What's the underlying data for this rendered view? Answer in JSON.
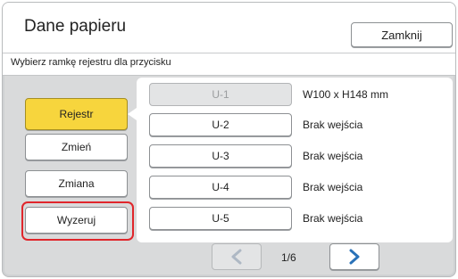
{
  "header": {
    "title": "Dane papieru",
    "close_label": "Zamknij"
  },
  "subtitle": "Wybierz ramkę rejestru dla przycisku",
  "actions": [
    {
      "label": "Rejestr",
      "active": true
    },
    {
      "label": "Zmień",
      "active": false
    },
    {
      "label": "Zmiana",
      "active": false
    },
    {
      "label": "Wyzeruj",
      "active": false,
      "highlighted": true
    }
  ],
  "slots": [
    {
      "label": "U-1",
      "status": "W100 x H148 mm",
      "disabled": true
    },
    {
      "label": "U-2",
      "status": "Brak wejścia",
      "disabled": false
    },
    {
      "label": "U-3",
      "status": "Brak wejścia",
      "disabled": false
    },
    {
      "label": "U-4",
      "status": "Brak wejścia",
      "disabled": false
    },
    {
      "label": "U-5",
      "status": "Brak wejścia",
      "disabled": false
    }
  ],
  "pagination": {
    "indicator": "1/6",
    "prev_icon": "chevron-left-icon",
    "next_icon": "chevron-right-icon",
    "prev_disabled": true
  },
  "colors": {
    "active": "#f7d53d",
    "highlight": "#e0262b",
    "arrow": "#2a72b8",
    "arrow_disabled": "#aeb8c4"
  }
}
